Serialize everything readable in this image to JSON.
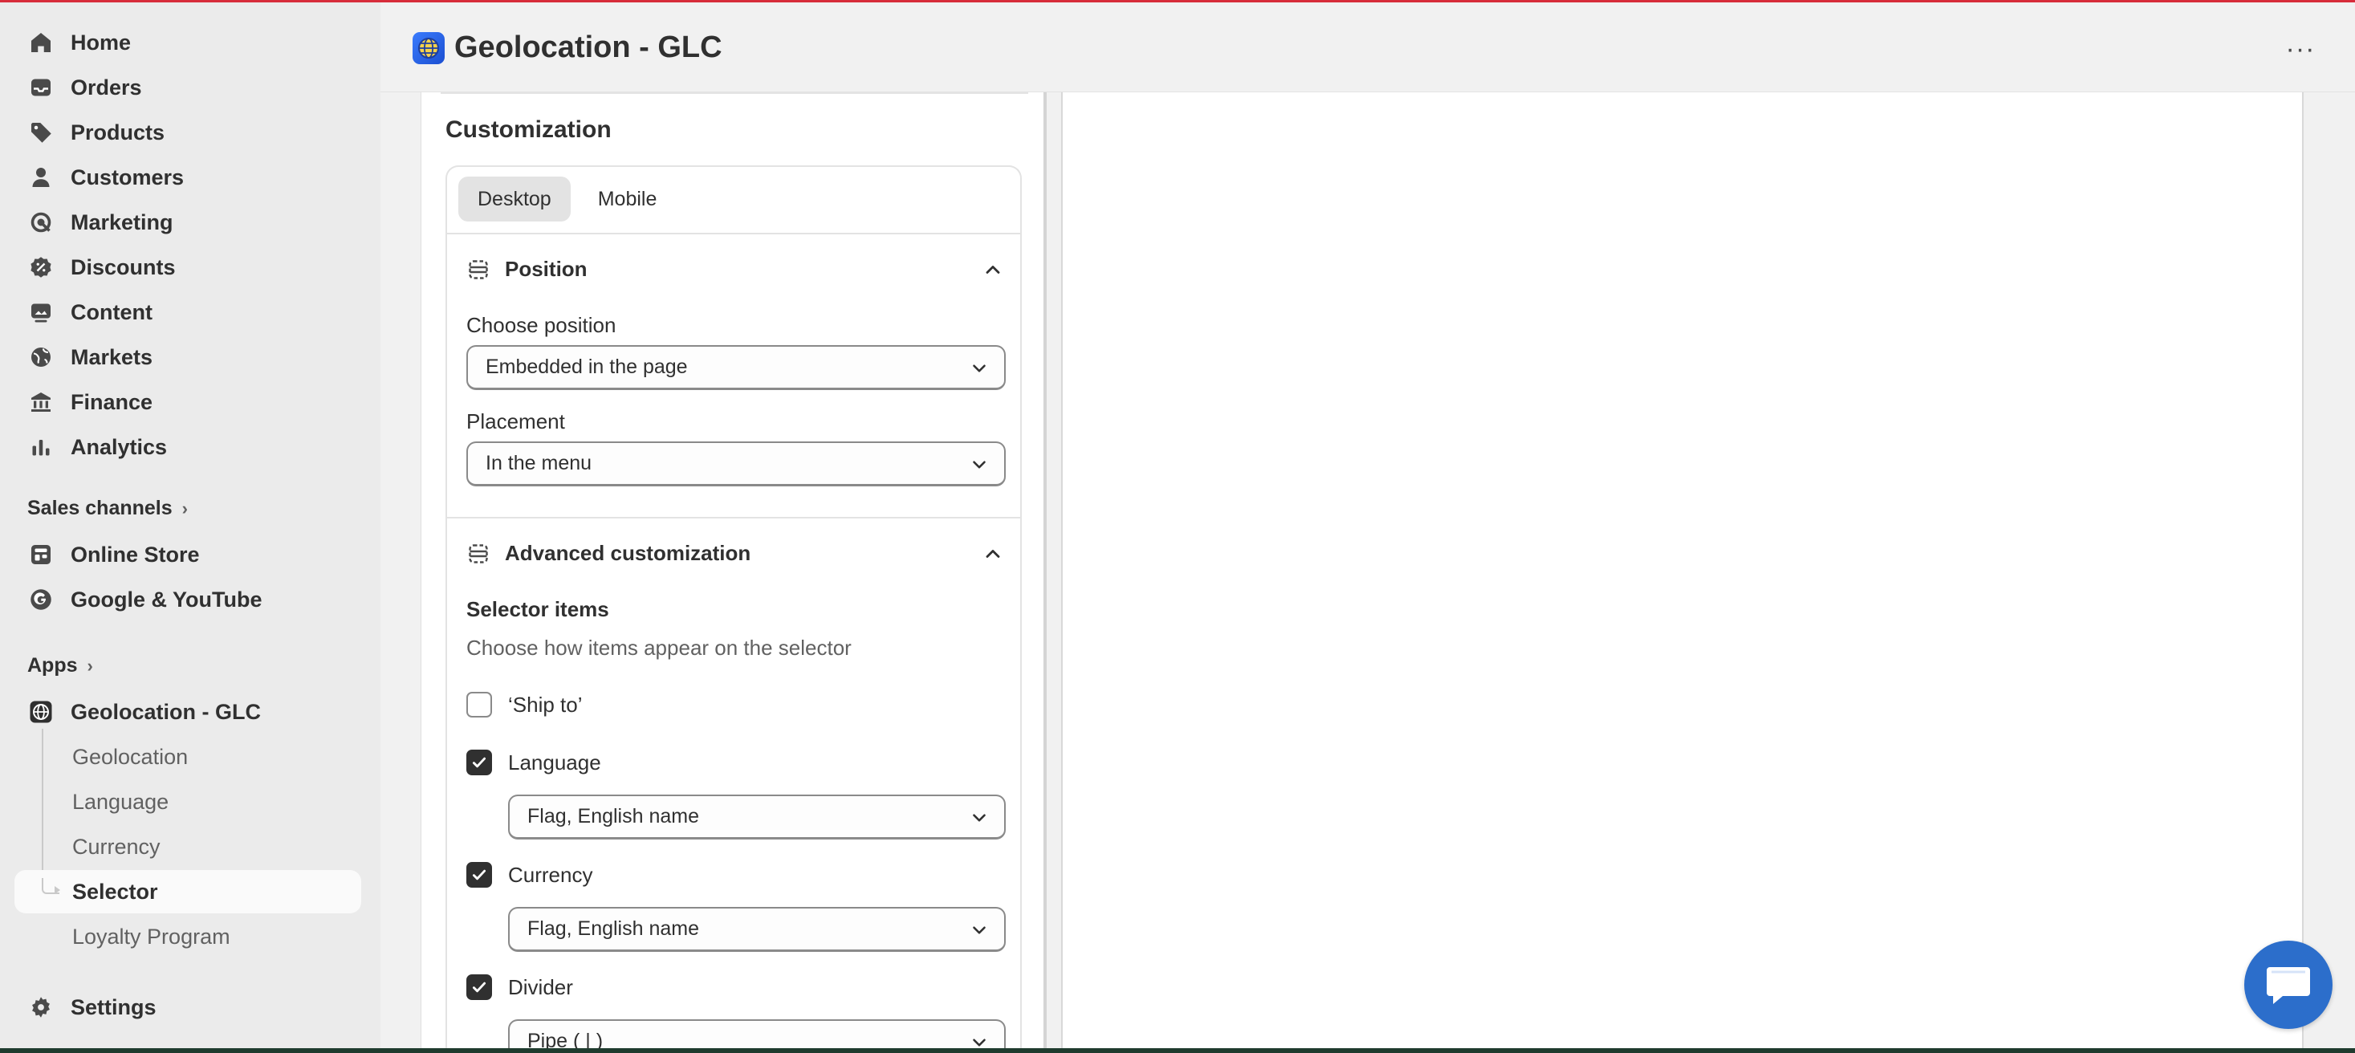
{
  "sidebar": {
    "items": [
      {
        "label": "Home",
        "icon": "home-icon"
      },
      {
        "label": "Orders",
        "icon": "inbox-icon"
      },
      {
        "label": "Products",
        "icon": "tag-icon"
      },
      {
        "label": "Customers",
        "icon": "person-icon"
      },
      {
        "label": "Marketing",
        "icon": "target-icon"
      },
      {
        "label": "Discounts",
        "icon": "discount-icon"
      },
      {
        "label": "Content",
        "icon": "image-icon"
      },
      {
        "label": "Markets",
        "icon": "globe-icon"
      },
      {
        "label": "Finance",
        "icon": "bank-icon"
      },
      {
        "label": "Analytics",
        "icon": "bar-chart-icon"
      }
    ],
    "sales_channels": {
      "title": "Sales channels",
      "items": [
        {
          "label": "Online Store",
          "icon": "store-icon"
        },
        {
          "label": "Google & YouTube",
          "icon": "google-icon"
        }
      ]
    },
    "apps": {
      "title": "Apps",
      "app_name": "Geolocation - GLC",
      "sub_items": [
        "Geolocation",
        "Language",
        "Currency",
        "Selector",
        "Loyalty Program"
      ],
      "active_sub_item": "Selector"
    },
    "settings_label": "Settings"
  },
  "header": {
    "title": "Geolocation - GLC",
    "more_icon": "ellipsis-icon"
  },
  "customization": {
    "title": "Customization",
    "tabs": [
      "Desktop",
      "Mobile"
    ],
    "active_tab": "Desktop",
    "position_section": {
      "title": "Position",
      "choose_position_label": "Choose position",
      "choose_position_value": "Embedded in the page",
      "placement_label": "Placement",
      "placement_value": "In the menu"
    },
    "advanced_section": {
      "title": "Advanced customization",
      "selector_items_label": "Selector items",
      "selector_items_help": "Choose how items appear on the selector",
      "items": [
        {
          "label": "‘Ship to’",
          "checked": false
        },
        {
          "label": "Language",
          "checked": true,
          "select_value": "Flag, English name"
        },
        {
          "label": "Currency",
          "checked": true,
          "select_value": "Flag, English name"
        },
        {
          "label": "Divider",
          "checked": true,
          "select_value": "Pipe ( | )"
        }
      ]
    }
  },
  "colors": {
    "accent": "#2c6ecb",
    "top_line": "#d72c3a",
    "text": "#303030",
    "muted": "#616161"
  }
}
